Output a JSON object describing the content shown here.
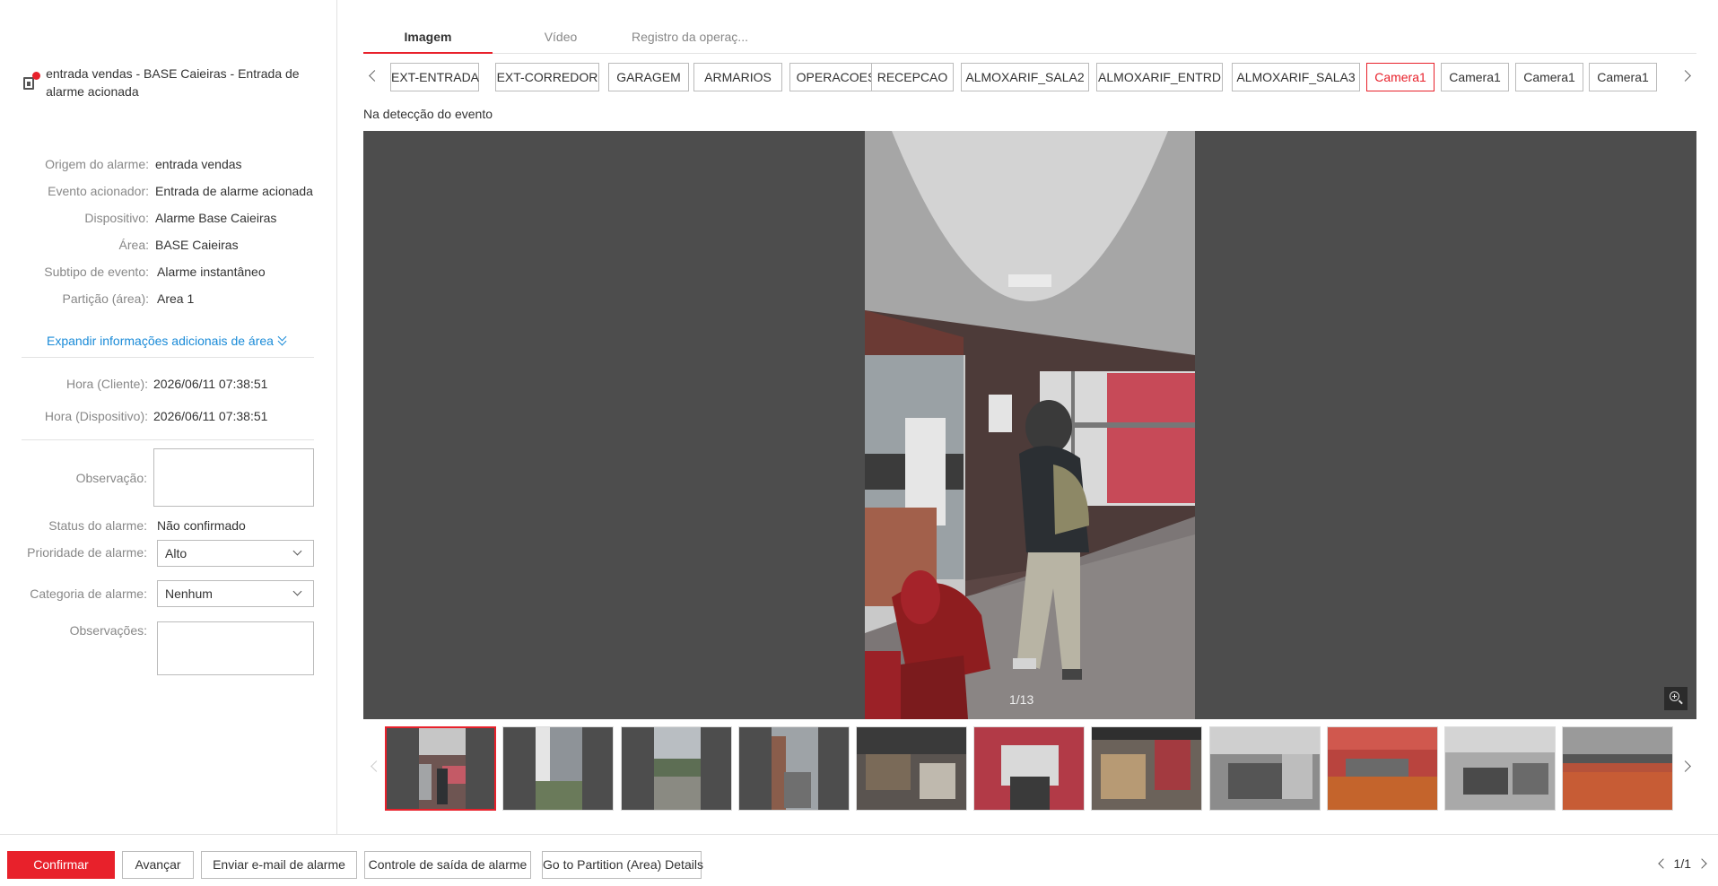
{
  "alarm": {
    "title": "entrada vendas - BASE Caieiras - Entrada de alarme acionada",
    "icon": "alarm-device-icon"
  },
  "details": [
    {
      "label": "Origem do alarme:",
      "value": "entrada vendas"
    },
    {
      "label": "Evento acionador:",
      "value": "Entrada de alarme acionada"
    },
    {
      "label": "Dispositivo:",
      "value": "Alarme Base Caieiras"
    },
    {
      "label": "Área:",
      "value": "BASE Caieiras"
    },
    {
      "label": "Subtipo de evento:",
      "value": "Alarme instantâneo"
    },
    {
      "label": "Partição (área):",
      "value": "Area 1"
    }
  ],
  "expand_label": "Expandir informações adicionais de área",
  "times": [
    {
      "label": "Hora (Cliente):",
      "value": "2026/06/11 07:38:51"
    },
    {
      "label": "Hora (Dispositivo):",
      "value": "2026/06/11 07:38:51"
    }
  ],
  "form": {
    "observacao_label": "Observação:",
    "observacao_value": "",
    "status_label": "Status do alarme:",
    "status_value": "Não confirmado",
    "priority_label": "Prioridade de alarme:",
    "priority_value": "Alto",
    "category_label": "Categoria de alarme:",
    "category_value": "Nenhum",
    "observacoes_label": "Observações:",
    "observacoes_value": ""
  },
  "buttons": {
    "confirm": "Confirmar",
    "next": "Avançar",
    "email": "Enviar e-mail de alarme",
    "output": "Controle de saída de alarme",
    "partition": "Go to Partition (Area) Details"
  },
  "pager": {
    "text": "1/1"
  },
  "tabs": [
    "Imagem",
    "Vídeo",
    "Registro da operaç..."
  ],
  "cameras": [
    "EXT-ENTRADA",
    "EXT-CORREDOR",
    "GARAGEM",
    "ARMARIOS",
    "OPERACOES",
    "RECEPCAO",
    "ALMOXARIF_SALA2",
    "ALMOXARIF_ENTRD",
    "ALMOXARIF_SALA3",
    "Camera1",
    "Camera1",
    "Camera1",
    "Camera1"
  ],
  "event_caption": "Na detecção do evento",
  "viewer": {
    "counter": "1/13"
  },
  "colors": {
    "accent": "#e8212b",
    "link": "#1a8bd8",
    "viewer_bg": "#4d4d4d"
  }
}
